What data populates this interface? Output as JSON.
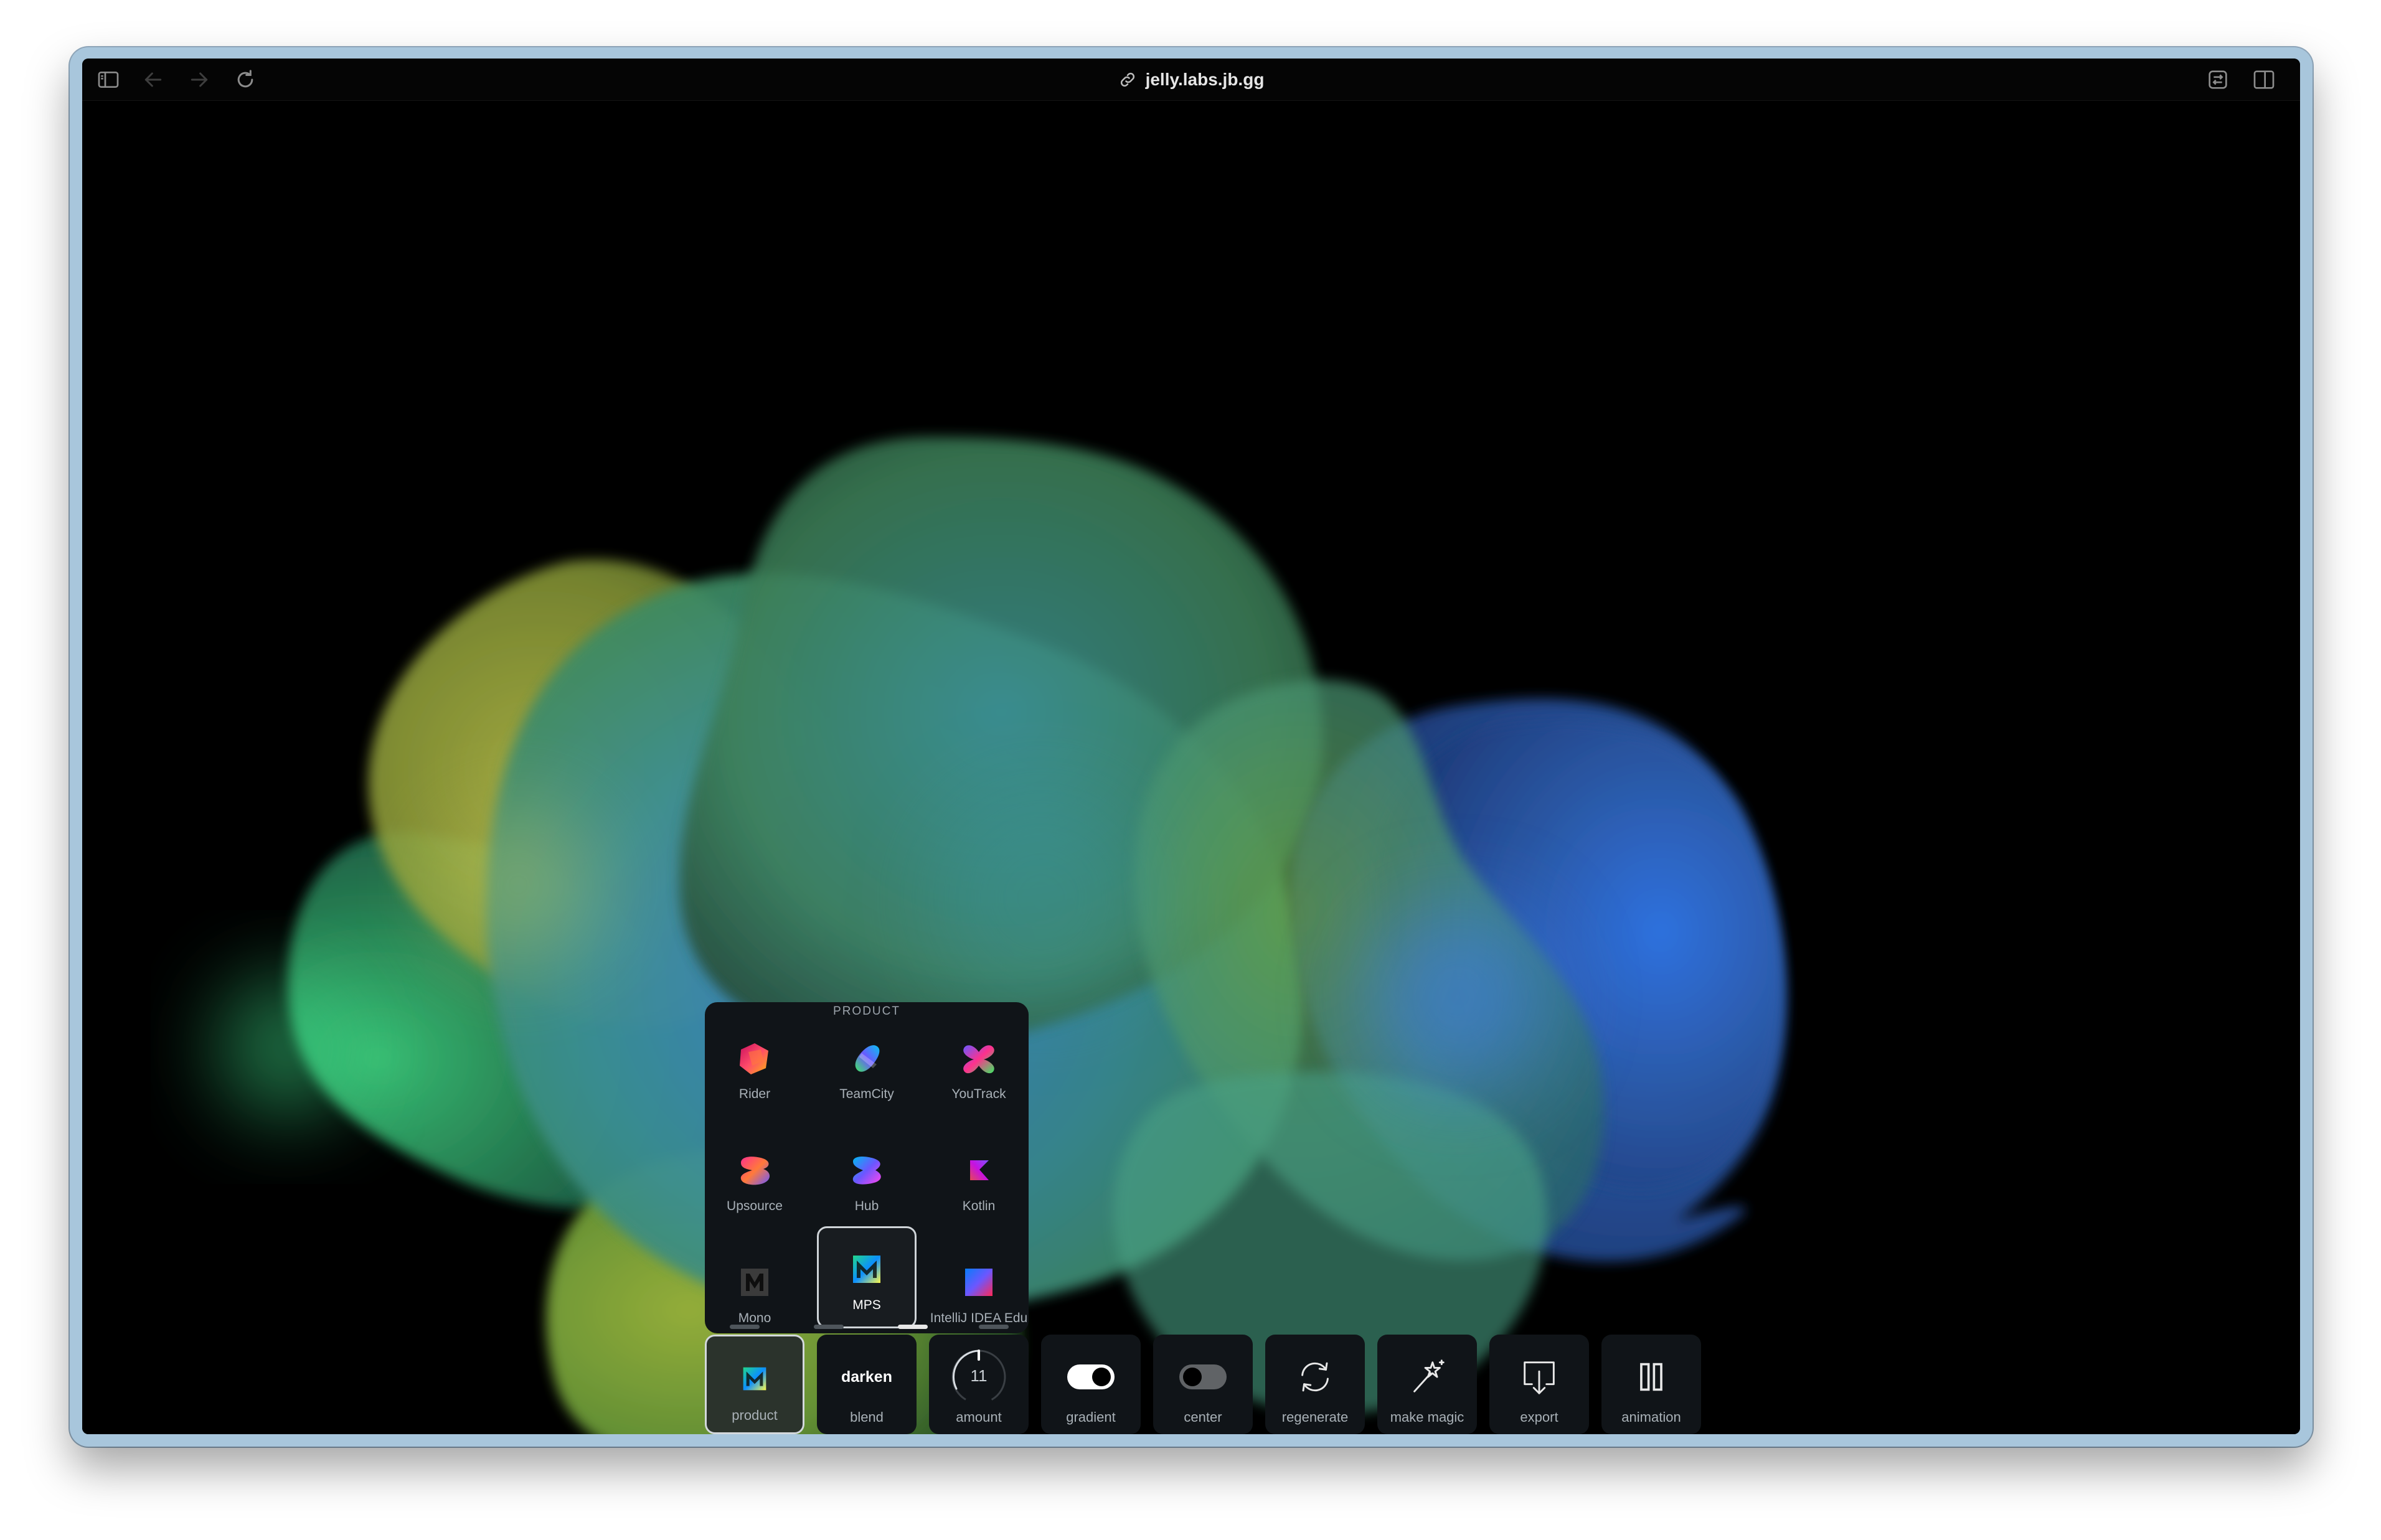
{
  "browser": {
    "url": "jelly.labs.jb.gg",
    "icons": {
      "sidebar": "sidebar-icon",
      "back": "arrow-left-icon",
      "forward": "arrow-right-icon",
      "reload": "reload-icon",
      "link": "link-icon",
      "translate": "translate-icon",
      "split": "split-view-icon"
    }
  },
  "picker": {
    "title": "PRODUCT",
    "products": [
      {
        "label": "Rider",
        "icon": "rider-logo"
      },
      {
        "label": "TeamCity",
        "icon": "teamcity-logo"
      },
      {
        "label": "YouTrack",
        "icon": "youtrack-logo"
      },
      {
        "label": "Upsource",
        "icon": "upsource-logo"
      },
      {
        "label": "Hub",
        "icon": "hub-logo"
      },
      {
        "label": "Kotlin",
        "icon": "kotlin-logo"
      },
      {
        "label": "Mono",
        "icon": "mono-logo"
      },
      {
        "label": "MPS",
        "icon": "mps-logo"
      },
      {
        "label": "IntelliJ IDEA Edu",
        "icon": "intellij-idea-edu-logo"
      }
    ],
    "selected": "MPS",
    "pages": 4,
    "current_page": 3
  },
  "controls": [
    {
      "label": "product",
      "kind": "logo",
      "icon": "mps-logo"
    },
    {
      "label": "blend",
      "kind": "text",
      "value": "darken"
    },
    {
      "label": "amount",
      "kind": "knob",
      "value": "11"
    },
    {
      "label": "gradient",
      "kind": "toggle",
      "on": true
    },
    {
      "label": "center",
      "kind": "toggle",
      "on": false
    },
    {
      "label": "regenerate",
      "kind": "icon",
      "icon": "regenerate-icon"
    },
    {
      "label": "make magic",
      "kind": "icon",
      "icon": "magic-wand-icon"
    },
    {
      "label": "export",
      "kind": "icon",
      "icon": "export-icon"
    },
    {
      "label": "animation",
      "kind": "icon",
      "icon": "pause-icon"
    }
  ]
}
